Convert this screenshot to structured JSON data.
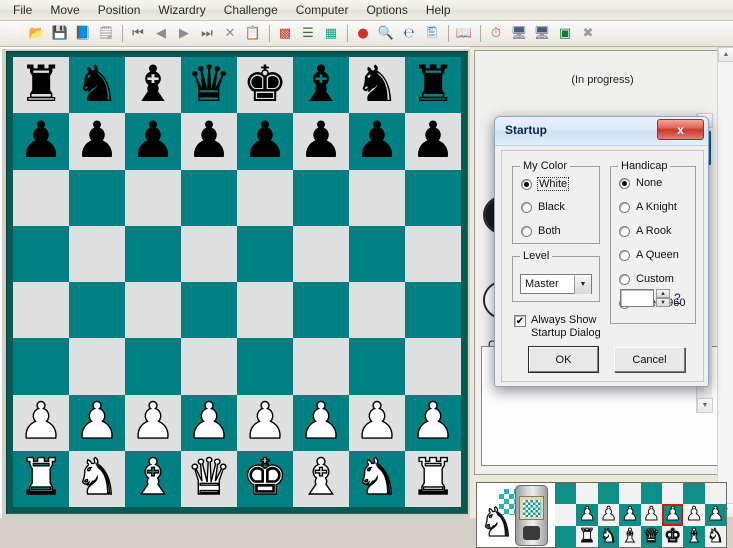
{
  "menu": {
    "items": [
      {
        "label": "File"
      },
      {
        "label": "Move"
      },
      {
        "label": "Position"
      },
      {
        "label": "Wizardry"
      },
      {
        "label": "Challenge"
      },
      {
        "label": "Computer"
      },
      {
        "label": "Options"
      },
      {
        "label": "Help"
      }
    ]
  },
  "toolbar": {
    "buttons": [
      {
        "name": "new-document-icon",
        "glyph": "🗋",
        "color": "#ffffff"
      },
      {
        "name": "open-folder-icon",
        "glyph": "📂",
        "color": "#e0a82e"
      },
      {
        "name": "save-disk-icon",
        "glyph": "💾",
        "color": "#9c9c9c"
      },
      {
        "name": "book-icon",
        "glyph": "📘",
        "color": "#19a7a0"
      },
      {
        "name": "properties-icon",
        "glyph": "🗒",
        "color": "#8c8c8c"
      },
      {
        "name": "separator-1",
        "glyph": "|",
        "color": ""
      },
      {
        "name": "first-move-icon",
        "glyph": "⏮",
        "color": "#6b6b6b"
      },
      {
        "name": "previous-move-icon",
        "glyph": "◀",
        "color": "#8d8d8d"
      },
      {
        "name": "next-move-icon",
        "glyph": "▶",
        "color": "#8d8d8d"
      },
      {
        "name": "last-move-icon",
        "glyph": "⏭",
        "color": "#6b6b6b"
      },
      {
        "name": "delete-move-icon",
        "glyph": "✕",
        "color": "#8d8d8d"
      },
      {
        "name": "clipboard-icon",
        "glyph": "📋",
        "color": "#8a8a3a"
      },
      {
        "name": "separator-2",
        "glyph": "|",
        "color": ""
      },
      {
        "name": "flip-board-icon",
        "glyph": "▩",
        "color": "#c23b22"
      },
      {
        "name": "move-list-icon",
        "glyph": "☰",
        "color": "#3b6b3b"
      },
      {
        "name": "board-pattern-icon",
        "glyph": "▦",
        "color": "#1f9a93"
      },
      {
        "name": "separator-3",
        "glyph": "|",
        "color": ""
      },
      {
        "name": "color-wheel-icon",
        "glyph": "●",
        "color": "#d22f2f"
      },
      {
        "name": "analysis-icon",
        "glyph": "🔍",
        "color": "#2f7fd6"
      },
      {
        "name": "internet-icon",
        "glyph": "℮",
        "color": "#1e62c8"
      },
      {
        "name": "export-icon",
        "glyph": "🖺",
        "color": "#3a7ad2"
      },
      {
        "name": "separator-4",
        "glyph": "|",
        "color": ""
      },
      {
        "name": "opening-book-icon",
        "glyph": "📖",
        "color": "#7a2a6a"
      },
      {
        "name": "separator-5",
        "glyph": "|",
        "color": ""
      },
      {
        "name": "clock-icon",
        "glyph": "⏱",
        "color": "#c04a4a"
      },
      {
        "name": "computer-icon",
        "glyph": "🖥",
        "color": "#4a5a7a"
      },
      {
        "name": "computer2-icon",
        "glyph": "🖥",
        "color": "#4a5a7a"
      },
      {
        "name": "console-icon",
        "glyph": "▣",
        "color": "#0b7a3a"
      },
      {
        "name": "stop-icon",
        "glyph": "✖",
        "color": "#9a9a9a"
      }
    ]
  },
  "board": {
    "light_color": "#dfdfdf",
    "dark_color": "#008080",
    "border_color": "#0a5a54",
    "rows": [
      [
        "r",
        "n",
        "b",
        "q",
        "k",
        "b",
        "n",
        "r"
      ],
      [
        "p",
        "p",
        "p",
        "p",
        "p",
        "p",
        "p",
        "p"
      ],
      [
        "",
        "",
        "",
        "",
        "",
        "",
        "",
        ""
      ],
      [
        "",
        "",
        "",
        "",
        "",
        "",
        "",
        ""
      ],
      [
        "",
        "",
        "",
        "",
        "",
        "",
        "",
        ""
      ],
      [
        "",
        "",
        "",
        "",
        "",
        "",
        "",
        ""
      ],
      [
        "P",
        "P",
        "P",
        "P",
        "P",
        "P",
        "P",
        "P"
      ],
      [
        "R",
        "N",
        "B",
        "Q",
        "K",
        "B",
        "N",
        "R"
      ]
    ],
    "glyphs": {
      "r": "♜",
      "n": "♞",
      "b": "♝",
      "q": "♛",
      "k": "♚",
      "p": "♟",
      "R": "♜",
      "N": "♞",
      "B": "♝",
      "Q": "♛",
      "K": "♚",
      "P": "♟"
    }
  },
  "right_panel": {
    "status": "(In progress)",
    "comment_label": "Co"
  },
  "banner": {
    "pieces_row1": [
      "",
      "P",
      "P",
      "P",
      "P",
      "P",
      "P",
      "P"
    ],
    "pieces_row2": [
      "",
      "R",
      "N",
      "B",
      "Q",
      "K",
      "B",
      "N"
    ],
    "highlight_index": 5
  },
  "dialog": {
    "title": "Startup",
    "close_label": "x",
    "my_color": {
      "group_label": "My Color",
      "options": [
        {
          "label": "White",
          "selected": true,
          "focused": true
        },
        {
          "label": "Black",
          "selected": false,
          "focused": false
        },
        {
          "label": "Both",
          "selected": false,
          "focused": false
        }
      ]
    },
    "handicap": {
      "group_label": "Handicap",
      "options": [
        {
          "label": "None",
          "selected": true
        },
        {
          "label": "A Knight",
          "selected": false
        },
        {
          "label": "A Rook",
          "selected": false
        },
        {
          "label": "A Queen",
          "selected": false
        },
        {
          "label": "Custom",
          "selected": false
        },
        {
          "label": "Chess960",
          "selected": false
        }
      ],
      "spinner_value": "",
      "help_label": "?"
    },
    "level": {
      "group_label": "Level",
      "selected": "Master",
      "options": [
        "Master"
      ]
    },
    "always_show": {
      "label_line1": "Always Show",
      "label_line2": "Startup Dialog",
      "checked": true,
      "check_glyph": "✔"
    },
    "ok_label": "OK",
    "cancel_label": "Cancel"
  }
}
